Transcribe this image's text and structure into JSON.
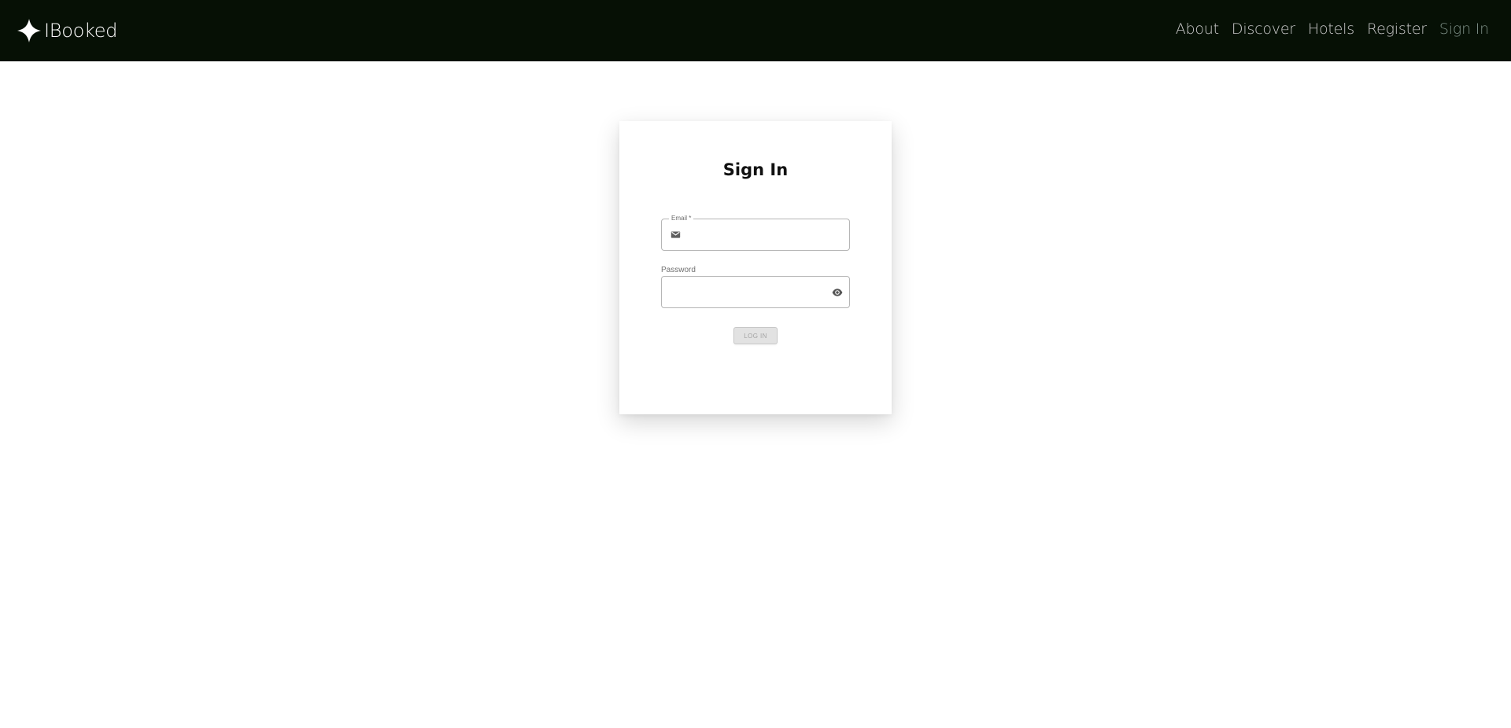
{
  "nav": {
    "brand": "IBooked",
    "links": [
      "About",
      "Discover",
      "Hotels",
      "Register",
      "Sign In"
    ]
  },
  "signin": {
    "title": "Sign In",
    "email_label": "Email *",
    "email_value": "",
    "password_label": "Password",
    "password_value": "",
    "login_label": "LOG IN"
  },
  "icons": {
    "logo": "four-point-star-icon",
    "email": "mail-icon",
    "password_toggle": "eye-icon"
  },
  "colors": {
    "navbar": "#061005",
    "nav_link": "#c9c9c9",
    "active_nav_link": "#7d8f86",
    "button_disabled": "#e2e2e2"
  }
}
